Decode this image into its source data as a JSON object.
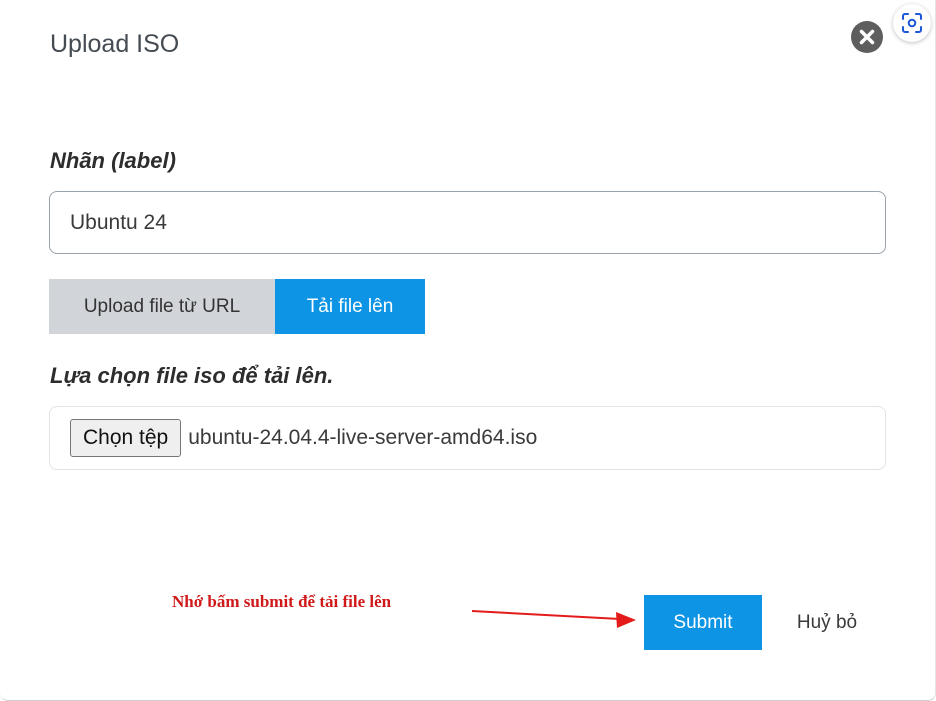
{
  "dialog": {
    "title": "Upload ISO"
  },
  "form": {
    "label_field_label": "Nhãn (label)",
    "label_value": "Ubuntu 24",
    "tabs": [
      {
        "label": "Upload file từ URL",
        "active": false
      },
      {
        "label": "Tải file lên",
        "active": true
      }
    ],
    "file_field_label": "Lựa chọn file iso để tải lên.",
    "choose_button_label": "Chọn tệp",
    "file_name": "ubuntu-24.04.4-live-server-amd64.iso"
  },
  "annotation": {
    "text": "Nhớ bấm submit để tải file lên",
    "color": "#d01a1a"
  },
  "actions": {
    "submit_label": "Submit",
    "cancel_label": "Huỷ bỏ"
  },
  "colors": {
    "accent": "#0d94e5",
    "inactive_tab": "#d1d5d9"
  },
  "icons": {
    "close": "close-icon",
    "lens": "google-lens-icon"
  }
}
